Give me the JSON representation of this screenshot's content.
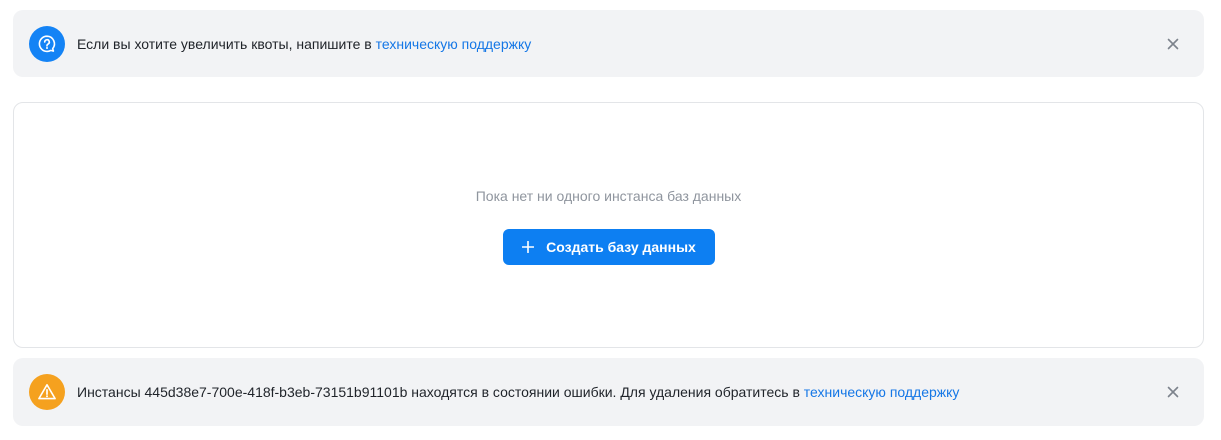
{
  "quota_alert": {
    "icon": "question-circle-icon",
    "text": "Если вы хотите увеличить квоты, напишите в ",
    "link_text": "техническую поддержку",
    "close_icon": "close-icon",
    "icon_color": "#1483f5"
  },
  "empty_state": {
    "message": "Пока нет ни одного инстанса баз данных",
    "button_label": "Создать базу данных",
    "button_icon": "plus-icon",
    "button_color": "#0d7ff2"
  },
  "error_alert": {
    "icon": "warning-triangle-icon",
    "text": "Инстансы 445d38e7-700e-418f-b3eb-73151b91101b находятся в состоянии ошибки. Для удаления обратитесь в ",
    "link_text": "техническую поддержку",
    "close_icon": "close-icon",
    "icon_color": "#f5a11f"
  },
  "colors": {
    "link": "#1577e6",
    "alert_bg": "#f2f3f5",
    "muted_text": "#8f959e"
  }
}
